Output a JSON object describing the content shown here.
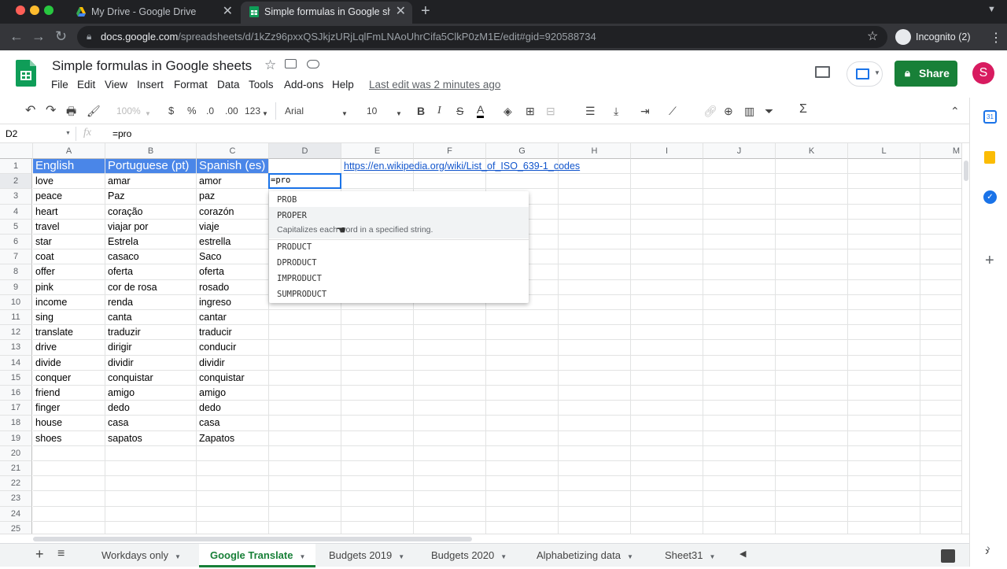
{
  "browser": {
    "tabs": [
      {
        "title": "My Drive - Google Drive",
        "close": "✕"
      },
      {
        "title": "Simple formulas in Google sheets",
        "close": "✕"
      }
    ],
    "new_tab": "+",
    "url_host": "docs.google.com",
    "url_path": "/spreadsheets/d/1kZz96pxxQSJkjzURjLqlFmLNAoUhrCifa5ClkP0zM1E/edit#gid=920588734",
    "incognito": "Incognito (2)"
  },
  "doc": {
    "title": "Simple formulas in Google sheets",
    "menu": [
      "File",
      "Edit",
      "View",
      "Insert",
      "Format",
      "Data",
      "Tools",
      "Add-ons",
      "Help"
    ],
    "last_edit": "Last edit was 2 minutes ago",
    "share": "Share",
    "avatar": "S"
  },
  "toolbar": {
    "zoom": "100%",
    "currency": "$",
    "percent": "%",
    "dec_less": ".0",
    "dec_more": ".00",
    "format": "123",
    "font": "Arial",
    "size": "10",
    "bold": "B",
    "italic": "I",
    "strike": "S",
    "textcolor": "A",
    "sigma": "Σ"
  },
  "formula_bar": {
    "cell_ref": "D2",
    "fx": "fx",
    "value": "=pro"
  },
  "grid": {
    "columns": [
      "A",
      "B",
      "C",
      "D",
      "E",
      "F",
      "G",
      "H",
      "I",
      "J",
      "K",
      "L",
      "M"
    ],
    "row_numbers": [
      "1",
      "2",
      "3",
      "4",
      "5",
      "6",
      "7",
      "8",
      "9",
      "10",
      "11",
      "12",
      "13",
      "14",
      "15",
      "16",
      "17",
      "18",
      "19",
      "20",
      "21",
      "22",
      "23",
      "24",
      "25"
    ],
    "header_row": [
      "English",
      "Portuguese (pt)",
      "Spanish (es)"
    ],
    "link": "https://en.wikipedia.org/wiki/List_of_ISO_639-1_codes",
    "rows": [
      [
        "love",
        "amar",
        "amor"
      ],
      [
        "peace",
        "Paz",
        "paz"
      ],
      [
        "heart",
        "coração",
        "corazón"
      ],
      [
        "travel",
        "viajar por",
        "viaje"
      ],
      [
        "star",
        "Estrela",
        "estrella"
      ],
      [
        "coat",
        "casaco",
        "Saco"
      ],
      [
        "offer",
        "oferta",
        "oferta"
      ],
      [
        "pink",
        "cor de rosa",
        "rosado"
      ],
      [
        "income",
        "renda",
        "ingreso"
      ],
      [
        "sing",
        "canta",
        "cantar"
      ],
      [
        "translate",
        "traduzir",
        "traducir"
      ],
      [
        "drive",
        "dirigir",
        "conducir"
      ],
      [
        "divide",
        "dividir",
        "dividir"
      ],
      [
        "conquer",
        "conquistar",
        "conquistar"
      ],
      [
        "friend",
        "amigo",
        "amigo"
      ],
      [
        "finger",
        "dedo",
        "dedo"
      ],
      [
        "house",
        "casa",
        "casa"
      ],
      [
        "shoes",
        "sapatos",
        "Zapatos"
      ]
    ],
    "active_cell_value": "=pro"
  },
  "autocomplete": {
    "items": [
      "PROB",
      "PROPER",
      "PRODUCT",
      "DPRODUCT",
      "IMPRODUCT",
      "SUMPRODUCT"
    ],
    "description": "Capitalizes each word in a specified string."
  },
  "sheets": {
    "add": "+",
    "list": "≡",
    "tabs": [
      "Workdays only",
      "Google Translate",
      "Budgets 2019",
      "Budgets 2020",
      "Alphabetizing data",
      "Sheet31"
    ],
    "active_index": 1
  },
  "colors": {
    "accent_green": "#188038",
    "header_blue": "#4a86e8",
    "selection_blue": "#1a73e8",
    "link_blue": "#1155cc"
  }
}
